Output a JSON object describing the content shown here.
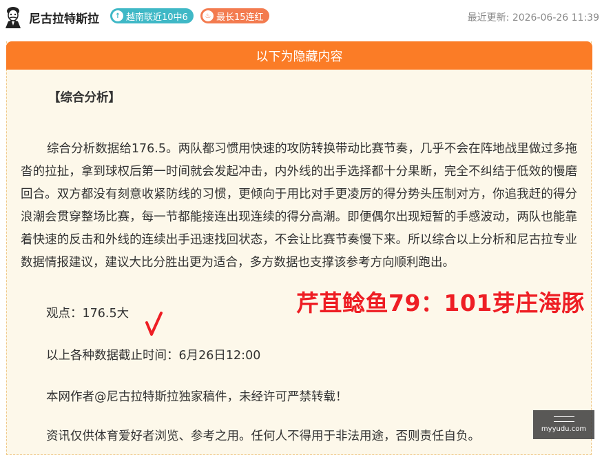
{
  "header": {
    "author": "尼古拉特斯拉",
    "badge_streak_recent": "越南联近10中6",
    "badge_longest": "最长15连红",
    "update_label": "最近更新:",
    "update_time": "2026-06-26 11:39"
  },
  "panel": {
    "title": "以下为隐藏内容"
  },
  "article": {
    "section_title": "【综合分析】",
    "paragraph": "综合分析数据给176.5。两队都习惯用快速的攻防转换带动比赛节奏，几乎不会在阵地战里做过多拖沓的拉扯，拿到球权后第一时间就会发起冲击，内外线的出手选择都十分果断，完全不纠结于低效的慢磨回合。双方都没有刻意收紧防线的习惯，更倾向于用比对手更凌厉的得分势头压制对方，你追我赶的得分浪潮会贯穿整场比赛，每一节都能接连出现连续的得分高潮。即便偶尔出现短暂的手感波动，两队也能靠着快速的反击和外线的连续出手迅速找回状态，不会让比赛节奏慢下来。所以综合以上分析和尼古拉专业数据情报建议，建议大比分胜出更为适合，多方数据也支撑该参考方向顺利跑出。",
    "viewpoint": "观点：176.5大",
    "cutoff": "以上各种数据截止时间：6月26日12:00",
    "copyright": "本网作者@尼古拉特斯拉独家稿件，未经许可严禁转载！",
    "disclaimer": "资讯仅供体育爱好者浏览、参考之用。任何人不得用于非法用途，否则责任自负。",
    "result_overlay": "芹苴鲶鱼79：101芽庄海豚",
    "check_mark": "√"
  },
  "watermark": {
    "domain": "myyudu.com"
  },
  "colors": {
    "accent_orange": "#fb7c26",
    "badge_teal": "#3fb8c6",
    "badge_orange": "#f37b4f",
    "result_red": "#ee1e24"
  }
}
